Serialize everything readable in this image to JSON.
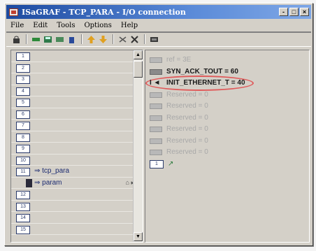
{
  "window": {
    "title": "ISaGRAF - TCP_PARA - I/O connection",
    "controls": [
      "-",
      "□",
      "×"
    ]
  },
  "menu": {
    "items": [
      "File",
      "Edit",
      "Tools",
      "Options",
      "Help"
    ]
  },
  "toolbar": {
    "icons": [
      "lock-icon",
      "link-icon",
      "save-icon",
      "print-icon",
      "trash-icon",
      "arrow-up-icon",
      "arrow-down-icon",
      "scale-icon",
      "tools-icon",
      "card-icon"
    ]
  },
  "left_panel": {
    "rows": [
      {
        "box": "1",
        "label": ""
      },
      {
        "box": "2",
        "label": ""
      },
      {
        "box": "3",
        "label": ""
      },
      {
        "box": "4",
        "label": ""
      },
      {
        "box": "5",
        "label": ""
      },
      {
        "box": "6",
        "label": ""
      },
      {
        "box": "7",
        "label": ""
      },
      {
        "box": "8",
        "label": ""
      },
      {
        "box": "9",
        "label": ""
      },
      {
        "box": "10",
        "label": ""
      },
      {
        "box": "11",
        "label": "⇒ tcp_para",
        "suffix": ""
      },
      {
        "box": "",
        "label": "⇒ param",
        "suffix": "⌂ ▸",
        "dark_icon": true
      },
      {
        "box": "12",
        "label": ""
      },
      {
        "box": "13",
        "label": ""
      },
      {
        "box": "14",
        "label": ""
      },
      {
        "box": "15",
        "label": ""
      }
    ]
  },
  "right_panel": {
    "items": [
      {
        "text": "ref = 3E",
        "style": "gray"
      },
      {
        "text": "SYN_ACK_TOUT = 60",
        "style": "bold"
      },
      {
        "text": "INIT_ETHERNET_T = 40",
        "style": "highlight",
        "marker": "I ◄"
      },
      {
        "text": "Reserved = 0",
        "style": "gray"
      },
      {
        "text": "Reserved = 0",
        "style": "gray"
      },
      {
        "text": "Reserved = 0",
        "style": "gray"
      },
      {
        "text": "Reserved = 0",
        "style": "gray"
      },
      {
        "text": "Reserved = 0",
        "style": "gray"
      },
      {
        "text": "Reserved = 0",
        "style": "gray"
      }
    ],
    "node": {
      "box": "1",
      "glyph": "↗"
    }
  },
  "colors": {
    "highlight": "#e05a5a",
    "titlebar": "#1c4aa0",
    "bold_text": "#1a1a1a",
    "gray_text": "#a8a8a8"
  }
}
